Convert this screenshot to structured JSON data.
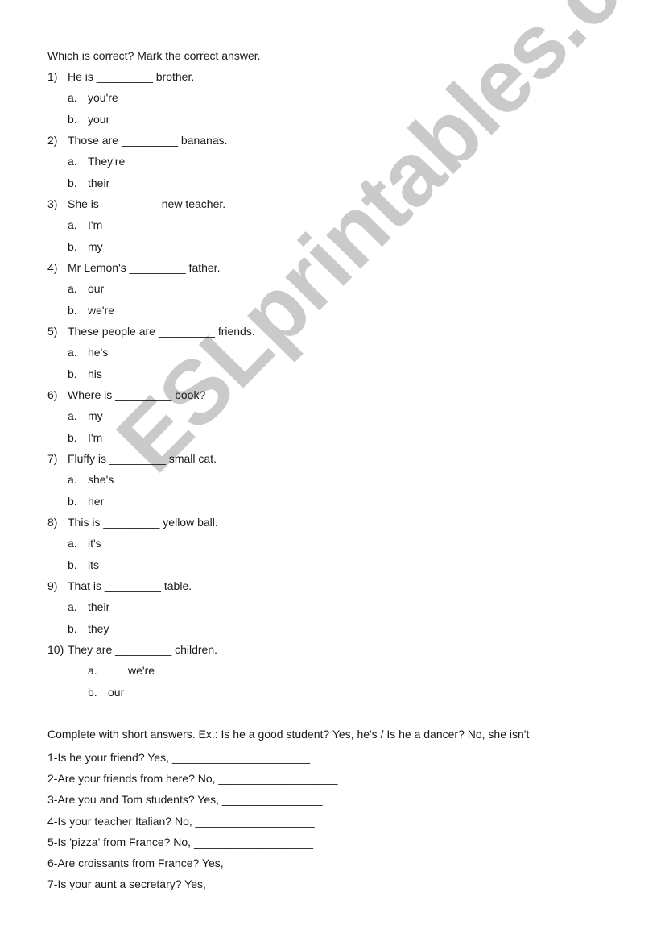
{
  "watermark": "ESLprintables.com",
  "section1": {
    "instruction": "Which is correct? Mark the correct answer.",
    "questions": [
      {
        "num": "1)",
        "text": "He is _________ brother.",
        "options": [
          {
            "letter": "a.",
            "text": "you're"
          },
          {
            "letter": "b.",
            "text": "your"
          }
        ]
      },
      {
        "num": "2)",
        "text": "Those are _________ bananas.",
        "options": [
          {
            "letter": "a.",
            "text": "They're"
          },
          {
            "letter": "b.",
            "text": "their"
          }
        ]
      },
      {
        "num": "3)",
        "text": "She is _________ new teacher.",
        "options": [
          {
            "letter": "a.",
            "text": "I'm"
          },
          {
            "letter": "b.",
            "text": "my"
          }
        ]
      },
      {
        "num": "4)",
        "text": "Mr Lemon's _________ father.",
        "options": [
          {
            "letter": "a.",
            "text": "our"
          },
          {
            "letter": "b.",
            "text": "we're"
          }
        ]
      },
      {
        "num": "5)",
        "text": "These people are _________ friends.",
        "options": [
          {
            "letter": "a.",
            "text": "he's"
          },
          {
            "letter": "b.",
            "text": "his"
          }
        ]
      },
      {
        "num": "6)",
        "text": "Where is _________ book?",
        "options": [
          {
            "letter": "a.",
            "text": "my"
          },
          {
            "letter": "b.",
            "text": "I'm"
          }
        ]
      },
      {
        "num": "7)",
        "text": "Fluffy is _________ small cat.",
        "options": [
          {
            "letter": "a.",
            "text": "she's"
          },
          {
            "letter": "b.",
            "text": "her"
          }
        ]
      },
      {
        "num": "8)",
        "text": "This is _________ yellow ball.",
        "options": [
          {
            "letter": "a.",
            "text": "it's"
          },
          {
            "letter": "b.",
            "text": "its"
          }
        ]
      },
      {
        "num": "9)",
        "text": "That is _________ table.",
        "options": [
          {
            "letter": "a.",
            "text": "their"
          },
          {
            "letter": "b.",
            "text": "they"
          }
        ]
      },
      {
        "num": "10)",
        "text": "They are _________ children.",
        "options": [
          {
            "letter": "a.",
            "text": "we're"
          },
          {
            "letter": "b.",
            "text": "our"
          }
        ]
      }
    ]
  },
  "section2": {
    "instruction": "Complete with short answers. Ex.: Is he a good student? Yes, he's / Is he a dancer? No, she isn't",
    "items": [
      "1-Is he your friend? Yes, ______________________",
      "2-Are your friends from here? No, ___________________",
      "3-Are you and Tom students? Yes, ________________",
      "4-Is your teacher Italian? No, ___________________",
      "5-Is 'pizza' from France? No, ___________________",
      "6-Are croissants from France? Yes, ________________",
      "7-Is your aunt a secretary? Yes, _____________________"
    ]
  }
}
